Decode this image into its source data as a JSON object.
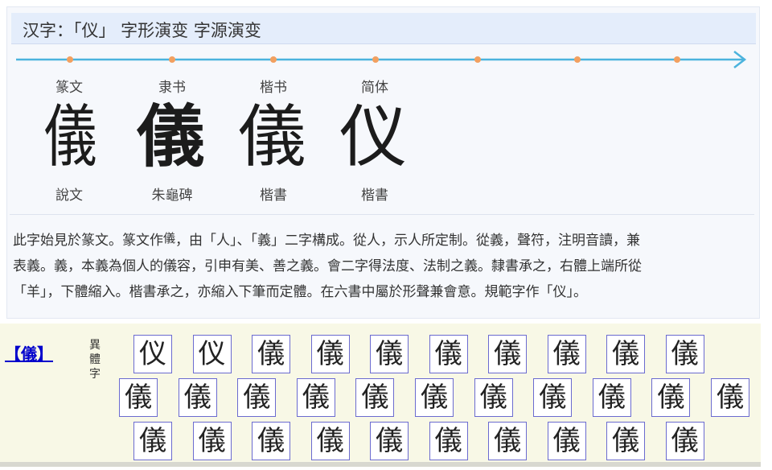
{
  "header": {
    "title": "汉字：「仪」 字形演变 字源演变"
  },
  "evolution": {
    "stages": [
      {
        "label": "篆文",
        "glyph": "儀",
        "source": "說文"
      },
      {
        "label": "隶书",
        "glyph": "儀",
        "source": "朱龜碑"
      },
      {
        "label": "楷书",
        "glyph": "儀",
        "source": "楷書"
      },
      {
        "label": "简体",
        "glyph": "仪",
        "source": "楷書"
      }
    ]
  },
  "description": {
    "line1_before": "此字始見於篆文。篆文作",
    "inline_glyph": "儀",
    "line1_after": "，由「人」、「義」二字構成。從人，示人所定制。從義，聲符，注明音讀，兼",
    "line2": "表義。義，本義為個人的儀容，引申有美、善之義。會二字得法度、法制之義。隸書承之，右體上端所從",
    "line3": "「羊」，下體縮入。楷書承之，亦縮入下筆而定體。在六書中屬於形聲兼會意。規範字作「仪」。"
  },
  "variants": {
    "head_link": "【儀】",
    "label_chars": [
      "異",
      "體",
      "字"
    ],
    "rows": [
      [
        "仪",
        "仪",
        "儀",
        "儀",
        "儀",
        "儀",
        "儀",
        "儀",
        "儀",
        "儀"
      ],
      [
        "儀",
        "儀",
        "儀",
        "儀",
        "儀",
        "儀",
        "儀",
        "儀",
        "儀",
        "儀",
        "儀"
      ],
      [
        "儀",
        "儀",
        "儀",
        "儀",
        "儀",
        "儀",
        "儀",
        "儀",
        "儀",
        "儀"
      ]
    ]
  },
  "colors": {
    "timeline": "#4bb3dd",
    "dot": "#f2a060",
    "link": "#0000cc",
    "box_border": "#6b6bd0"
  }
}
